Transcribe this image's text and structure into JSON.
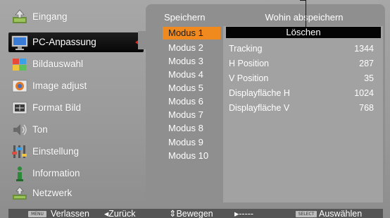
{
  "left_menu": {
    "items": [
      {
        "label": "Eingang",
        "icon": "input-icon"
      },
      {
        "label": "PC-Anpassung",
        "icon": "pc-adjust-icon"
      },
      {
        "label": "Bildauswahl",
        "icon": "image-select-icon"
      },
      {
        "label": "Image adjust",
        "icon": "image-adjust-icon"
      },
      {
        "label": "Format Bild",
        "icon": "screen-format-icon"
      },
      {
        "label": "Ton",
        "icon": "sound-icon"
      },
      {
        "label": "Einstellung",
        "icon": "setting-icon"
      },
      {
        "label": "Information",
        "icon": "information-icon"
      },
      {
        "label": "Netzwerk",
        "icon": "network-icon"
      }
    ],
    "selected_index": 1
  },
  "submenu": {
    "title": "Speichern",
    "target_title": "Wohin abspeichern",
    "modes": [
      "Modus 1",
      "Modus 2",
      "Modus 3",
      "Modus 4",
      "Modus 5",
      "Modus 6",
      "Modus 7",
      "Modus 8",
      "Modus 9",
      "Modus 10"
    ],
    "selected_mode_index": 0,
    "delete_label": "Löschen",
    "params": [
      {
        "name": "Tracking",
        "value": "1344"
      },
      {
        "name": "H Position",
        "value": "287"
      },
      {
        "name": "V Position",
        "value": "35"
      },
      {
        "name": "Displayfläche H",
        "value": "1024"
      },
      {
        "name": "Displayfläche V",
        "value": "768"
      }
    ]
  },
  "bottom_bar": {
    "exit_key": "MENU",
    "exit": "Verlassen",
    "back": "◂Zurück",
    "move": "⇕Bewegen",
    "next": "▸-----",
    "select_key": "SELECT",
    "select": "Auswählen"
  },
  "colors": {
    "background": "#9a9a9a",
    "panel": "#8f8f8f",
    "selected_item": "#0a0a0a",
    "pointer_red": "#e2231a",
    "mode_highlight": "#f08a1e",
    "delete_bar": "#050505"
  }
}
